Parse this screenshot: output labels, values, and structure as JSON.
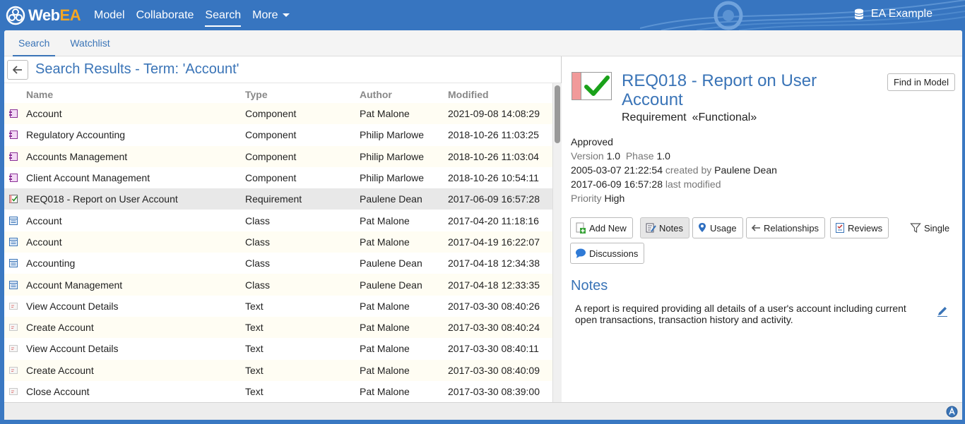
{
  "app": {
    "logo_text_1": "Web",
    "logo_text_2": "EA",
    "model_name": "EA Example"
  },
  "nav": {
    "items": [
      {
        "label": "Model",
        "active": false
      },
      {
        "label": "Collaborate",
        "active": false
      },
      {
        "label": "Search",
        "active": true
      },
      {
        "label": "More",
        "active": false
      }
    ]
  },
  "tabs": [
    {
      "label": "Search",
      "active": true
    },
    {
      "label": "Watchlist",
      "active": false
    }
  ],
  "search": {
    "title": "Search Results - Term: 'Account'",
    "columns": {
      "name": "Name",
      "type": "Type",
      "author": "Author",
      "modified": "Modified"
    },
    "rows": [
      {
        "icon": "component",
        "name": "Account",
        "type": "Component",
        "author": "Pat Malone",
        "modified": "2021-09-08 14:08:29"
      },
      {
        "icon": "component",
        "name": "Regulatory Accounting",
        "type": "Component",
        "author": "Philip Marlowe",
        "modified": "2018-10-26 11:03:25"
      },
      {
        "icon": "component",
        "name": "Accounts Management",
        "type": "Component",
        "author": "Philip Marlowe",
        "modified": "2018-10-26 11:03:04"
      },
      {
        "icon": "component",
        "name": "Client Account Management",
        "type": "Component",
        "author": "Philip Marlowe",
        "modified": "2018-10-26 10:54:11"
      },
      {
        "icon": "requirement",
        "name": "REQ018 - Report on User Account",
        "type": "Requirement",
        "author": "Paulene Dean",
        "modified": "2017-06-09 16:57:28",
        "selected": true
      },
      {
        "icon": "class",
        "name": "Account",
        "type": "Class",
        "author": "Pat Malone",
        "modified": "2017-04-20 11:18:16"
      },
      {
        "icon": "class",
        "name": "Account",
        "type": "Class",
        "author": "Pat Malone",
        "modified": "2017-04-19 16:22:07"
      },
      {
        "icon": "class",
        "name": "Accounting",
        "type": "Class",
        "author": "Paulene Dean",
        "modified": "2017-04-18 12:34:38"
      },
      {
        "icon": "class",
        "name": "Account Management",
        "type": "Class",
        "author": "Paulene Dean",
        "modified": "2017-04-18 12:33:35"
      },
      {
        "icon": "text",
        "name": "View Account Details",
        "type": "Text",
        "author": "Pat Malone",
        "modified": "2017-03-30 08:40:26"
      },
      {
        "icon": "text",
        "name": "Create Account",
        "type": "Text",
        "author": "Pat Malone",
        "modified": "2017-03-30 08:40:24"
      },
      {
        "icon": "text",
        "name": "View Account Details",
        "type": "Text",
        "author": "Pat Malone",
        "modified": "2017-03-30 08:40:11"
      },
      {
        "icon": "text",
        "name": "Create Account",
        "type": "Text",
        "author": "Pat Malone",
        "modified": "2017-03-30 08:40:09"
      },
      {
        "icon": "text",
        "name": "Close Account",
        "type": "Text",
        "author": "Pat Malone",
        "modified": "2017-03-30 08:39:00"
      }
    ]
  },
  "detail": {
    "title": "REQ018 - Report on User Account",
    "element_type": "Requirement",
    "stereotype": "«Functional»",
    "find_button": "Find in Model",
    "status": "Approved",
    "version_label": "Version",
    "version": "1.0",
    "phase_label": "Phase",
    "phase": "1.0",
    "created_date": "2005-03-07 21:22:54",
    "created_by_label": "created by",
    "created_by": "Paulene Dean",
    "modified_date": "2017-06-09 16:57:28",
    "modified_label": "last modified",
    "priority_label": "Priority",
    "priority": "High",
    "buttons": {
      "add_new": "Add New",
      "notes": "Notes",
      "usage": "Usage",
      "relationships": "Relationships",
      "reviews": "Reviews",
      "single": "Single",
      "discussions": "Discussions"
    },
    "notes_heading": "Notes",
    "notes_text": "A report is required providing all details of a user's account including current open transactions, transaction history and activity."
  },
  "colors": {
    "brand_blue": "#3775c0",
    "link_blue": "#3a74b7",
    "accent_orange": "#f5a623"
  }
}
